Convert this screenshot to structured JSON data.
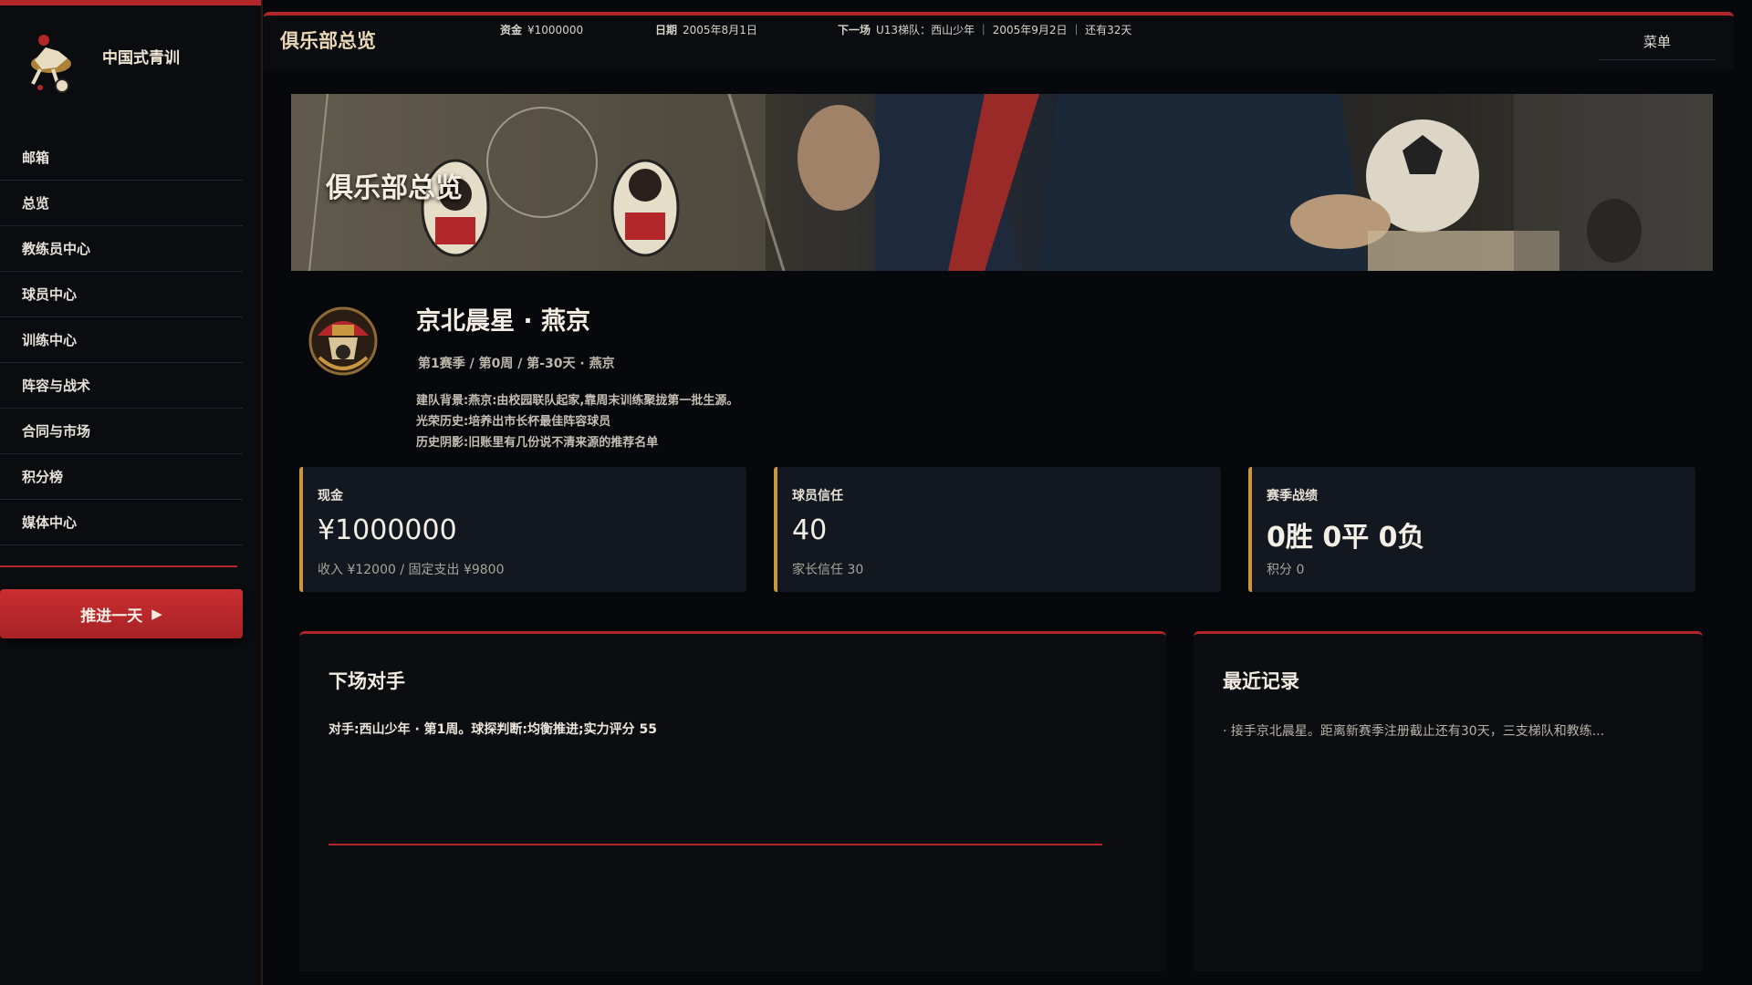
{
  "sidebar": {
    "brand": "中国式青训",
    "items": [
      {
        "label": "邮箱"
      },
      {
        "label": "总览"
      },
      {
        "label": "教练员中心"
      },
      {
        "label": "球员中心"
      },
      {
        "label": "训练中心"
      },
      {
        "label": "阵容与战术"
      },
      {
        "label": "合同与市场"
      },
      {
        "label": "积分榜"
      },
      {
        "label": "媒体中心"
      }
    ],
    "advance_label": "推进一天",
    "advance_icon": "▶"
  },
  "header": {
    "title": "俱乐部总览",
    "funds_label": "资金",
    "funds_value": "¥1000000",
    "date_label": "日期",
    "date_value": "2005年8月1日",
    "next_label": "下一场",
    "next_value": "U13梯队：西山少年 ｜ 2005年9月2日 ｜ 还有32天",
    "menu_label": "菜单"
  },
  "banner": {
    "title": "俱乐部总览"
  },
  "club": {
    "name": "京北晨星 · 燕京",
    "meta": "第1赛季 / 第0周 / 第-30天 · 燕京",
    "lore": [
      "建队背景:燕京:由校园联队起家,靠周末训练聚拢第一批生源。",
      "光荣历史:培养出市长杯最佳阵容球员",
      "历史阴影:旧账里有几份说不清来源的推荐名单"
    ]
  },
  "stats": [
    {
      "label": "现金",
      "value": "¥1000000",
      "sub": "收入 ¥12000 / 固定支出 ¥9800"
    },
    {
      "label": "球员信任",
      "value": "40",
      "sub": "家长信任 30"
    },
    {
      "label": "赛季战绩",
      "value": "0胜 0平 0负",
      "sub": "积分 0"
    }
  ],
  "next_match": {
    "title": "下场对手",
    "text": "对手:西山少年 · 第1周。球探判断:均衡推进;实力评分 55"
  },
  "recent": {
    "title": "最近记录",
    "items": [
      "· 接手京北晨星。距离新赛季注册截止还有30天，三支梯队和教练..."
    ]
  },
  "colors": {
    "accent_red": "#b3262a",
    "accent_gold": "#c9973f",
    "background": "#07080b",
    "card": "#131820"
  },
  "icons": {
    "brand": "soccer-player-logo",
    "crest": "club-crest",
    "advance": "play-icon"
  }
}
